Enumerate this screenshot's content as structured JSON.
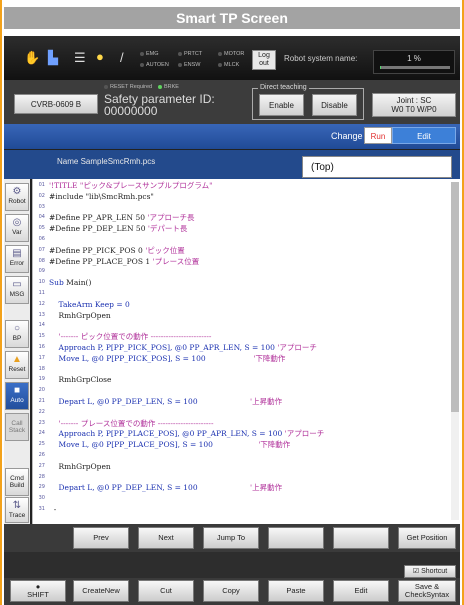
{
  "title": "Smart TP Screen",
  "status": {
    "indicators_row1": [
      "EMG",
      "PRTCT",
      "MOTOR"
    ],
    "indicators_row2": [
      "AUTOEN",
      "ENSW",
      "MLCK"
    ],
    "log_btn": "Log out",
    "system_name_label": "Robot system name:",
    "speed": "1 %",
    "speed_level_percent": 1
  },
  "second": {
    "controller": "CVRB-0609 B",
    "safety_line1": "Safety parameter ID:",
    "safety_line2": "00000000",
    "reset_required": "RESET Required",
    "brake": "BRKE",
    "direct_teaching": "Direct teaching",
    "enable": "Enable",
    "disable": "Disable",
    "joint_line1": "Joint : SC",
    "joint_line2": "W0 T0 W/P0"
  },
  "change": {
    "label": "Change",
    "run": "Run",
    "edit": "Edit"
  },
  "name_label": "Name SampleSmcRmh.pcs",
  "top_box": "(Top)",
  "left_buttons": [
    {
      "label": "Robot"
    },
    {
      "label": "Var"
    },
    {
      "label": "Error"
    },
    {
      "label": "MSG"
    },
    {
      "label": "BP"
    },
    {
      "label": "Reset"
    },
    {
      "label": "Auto"
    },
    {
      "label": "Call Stack"
    },
    {
      "label": "Cmd Build"
    },
    {
      "label": "Trace"
    }
  ],
  "code_lines": [
    {
      "n": "01",
      "seg": [
        {
          "t": "'!TITLE \"ピック&プレースサンプルプログラム\"",
          "c": "ct"
        }
      ]
    },
    {
      "n": "02",
      "seg": [
        {
          "t": "#include \"lib\\SmcRmh.pcs\"",
          "c": "tx"
        }
      ]
    },
    {
      "n": "03",
      "seg": []
    },
    {
      "n": "04",
      "seg": [
        {
          "t": "#Define PP_APR_LEN 50 ",
          "c": "tx"
        },
        {
          "t": "'アプローチ長",
          "c": "ct"
        }
      ]
    },
    {
      "n": "05",
      "seg": [
        {
          "t": "#Define PP_DEP_LEN 50 ",
          "c": "tx"
        },
        {
          "t": "'デパート長",
          "c": "ct"
        }
      ]
    },
    {
      "n": "06",
      "seg": []
    },
    {
      "n": "07",
      "seg": [
        {
          "t": "#Define PP_PICK_POS 0 ",
          "c": "tx"
        },
        {
          "t": "'ピック位置",
          "c": "ct"
        }
      ]
    },
    {
      "n": "08",
      "seg": [
        {
          "t": "#Define PP_PLACE_POS 1 ",
          "c": "tx"
        },
        {
          "t": "'プレース位置",
          "c": "ct"
        }
      ]
    },
    {
      "n": "09",
      "seg": []
    },
    {
      "n": "10",
      "seg": [
        {
          "t": "Sub ",
          "c": "kw"
        },
        {
          "t": "Main()",
          "c": "tx"
        }
      ]
    },
    {
      "n": "11",
      "seg": []
    },
    {
      "n": "12",
      "seg": [
        {
          "t": "    TakeArm Keep = 0",
          "c": "kw"
        }
      ]
    },
    {
      "n": "13",
      "seg": [
        {
          "t": "    RmhGrpOpen",
          "c": "tx"
        }
      ]
    },
    {
      "n": "14",
      "seg": []
    },
    {
      "n": "15",
      "seg": [
        {
          "t": "    '------- ピック位置での動作 ------------------------",
          "c": "ct"
        }
      ]
    },
    {
      "n": "16",
      "seg": [
        {
          "t": "    Approach P, P[PP_PICK_POS], @0 PP_APR_LEN, S = 100 ",
          "c": "kw"
        },
        {
          "t": "'アプローチ",
          "c": "ct"
        }
      ]
    },
    {
      "n": "17",
      "seg": [
        {
          "t": "    Move L, @0 P[PP_PICK_POS], S = 100",
          "c": "kw"
        },
        {
          "t": "                    '下降動作",
          "c": "ct"
        }
      ]
    },
    {
      "n": "18",
      "seg": []
    },
    {
      "n": "19",
      "seg": [
        {
          "t": "    RmhGrpClose",
          "c": "tx"
        }
      ]
    },
    {
      "n": "20",
      "seg": []
    },
    {
      "n": "21",
      "seg": [
        {
          "t": "    Depart L, @0 PP_DEP_LEN, S = 100",
          "c": "kw"
        },
        {
          "t": "                      '上昇動作",
          "c": "ct"
        }
      ]
    },
    {
      "n": "22",
      "seg": []
    },
    {
      "n": "23",
      "seg": [
        {
          "t": "    '------- プレース位置での動作 ----------------------",
          "c": "ct"
        }
      ]
    },
    {
      "n": "24",
      "seg": [
        {
          "t": "    Approach P, P[PP_PLACE_POS], @0 PP_APR_LEN, S = 100 ",
          "c": "kw"
        },
        {
          "t": "'アプローチ",
          "c": "ct"
        }
      ]
    },
    {
      "n": "25",
      "seg": [
        {
          "t": "    Move L, @0 P[PP_PLACE_POS], S = 100",
          "c": "kw"
        },
        {
          "t": "                   '下降動作",
          "c": "ct"
        }
      ]
    },
    {
      "n": "26",
      "seg": []
    },
    {
      "n": "27",
      "seg": [
        {
          "t": "    RmhGrpOpen",
          "c": "tx"
        }
      ]
    },
    {
      "n": "28",
      "seg": []
    },
    {
      "n": "29",
      "seg": [
        {
          "t": "    Depart L, @0 PP_DEP_LEN, S = 100",
          "c": "kw"
        },
        {
          "t": "                      '上昇動作",
          "c": "ct"
        }
      ]
    },
    {
      "n": "30",
      "seg": []
    },
    {
      "n": "31",
      "seg": [
        {
          "t": "  -",
          "c": "tx"
        }
      ]
    }
  ],
  "func_row1": [
    "Prev",
    "Next",
    "Jump To",
    "",
    "",
    "Get Position"
  ],
  "shortcut": "Shortcut",
  "func_row2": [
    "SHIFT",
    "CreateNew",
    "Cut",
    "Copy",
    "Paste",
    "Edit",
    "Save & CheckSyntax"
  ]
}
